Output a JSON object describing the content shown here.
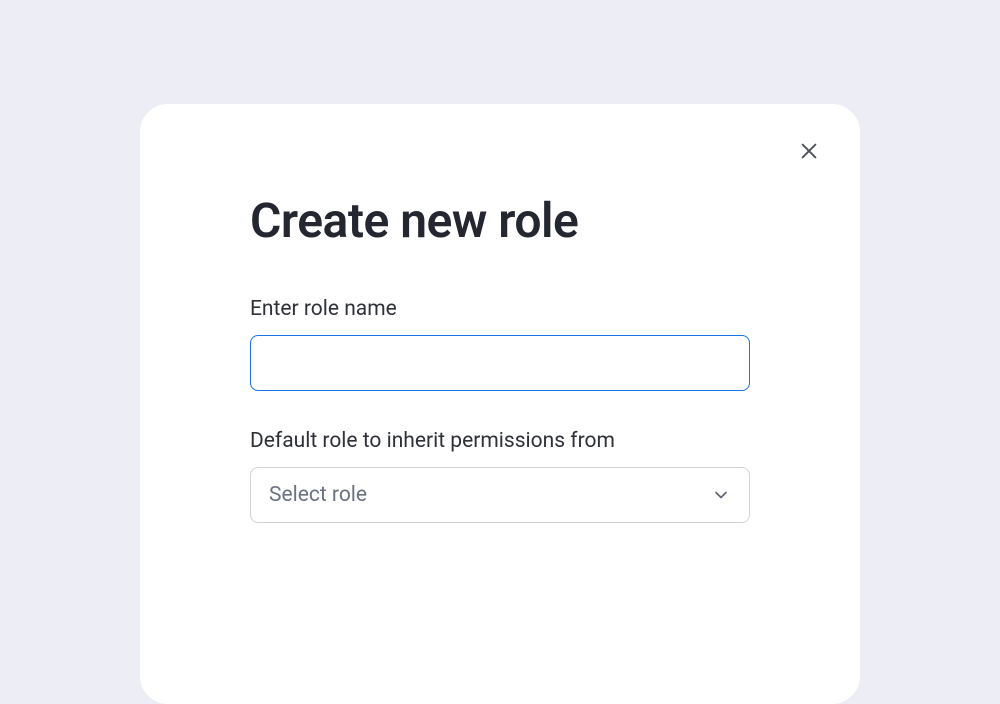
{
  "modal": {
    "title": "Create new role",
    "roleName": {
      "label": "Enter role name",
      "value": "",
      "placeholder": ""
    },
    "defaultRole": {
      "label": "Default role to inherit permissions from",
      "selected": "Select role"
    }
  }
}
